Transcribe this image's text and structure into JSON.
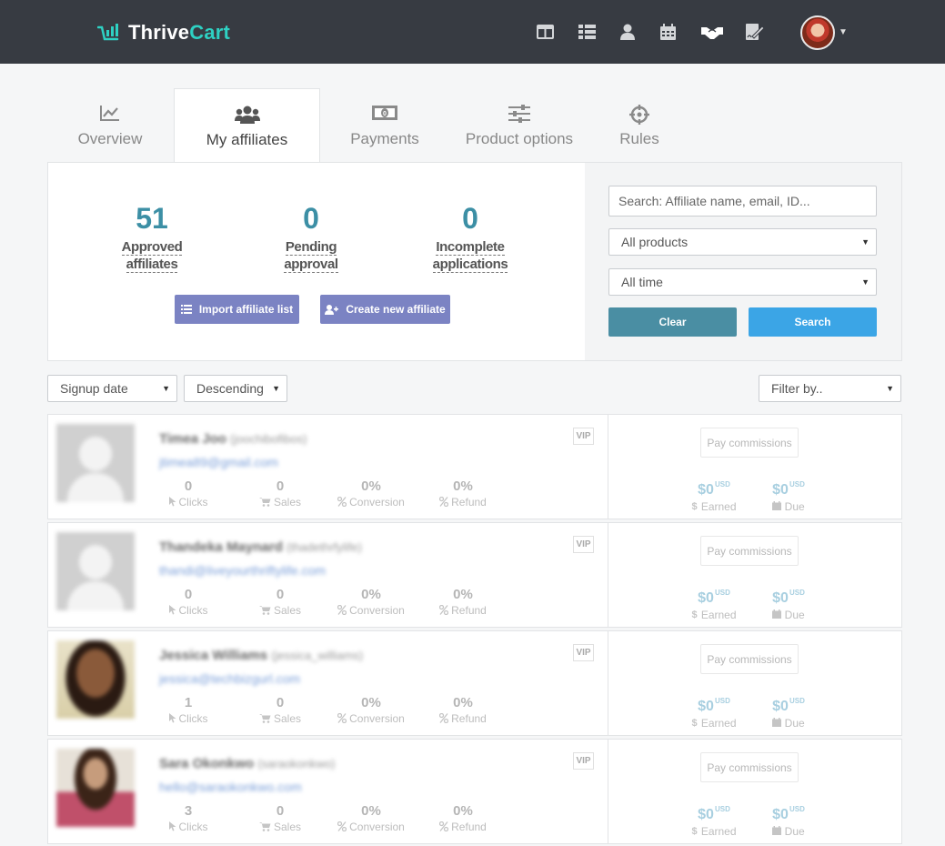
{
  "header": {
    "brand_left": "Thrive",
    "brand_right": "Cart",
    "nav_icons": [
      "dashboard-icon",
      "products-icon",
      "user-icon",
      "calendar-icon",
      "affiliates-handshake-icon",
      "signature-icon"
    ]
  },
  "tabs": [
    {
      "label": "Overview",
      "icon": "chart-icon"
    },
    {
      "label": "My affiliates",
      "icon": "users-icon"
    },
    {
      "label": "Payments",
      "icon": "money-icon"
    },
    {
      "label": "Product options",
      "icon": "sliders-icon"
    },
    {
      "label": "Rules",
      "icon": "crosshair-icon"
    }
  ],
  "stats": [
    {
      "value": "51",
      "line1": "Approved",
      "line2": "affiliates"
    },
    {
      "value": "0",
      "line1": "Pending",
      "line2": "approval"
    },
    {
      "value": "0",
      "line1": "Incomplete",
      "line2": "applications"
    }
  ],
  "actions": {
    "import_label": "Import affiliate list",
    "create_label": "Create new affiliate"
  },
  "search": {
    "placeholder": "Search: Affiliate name, email, ID...",
    "product_filter": "All products",
    "time_filter": "All time",
    "clear_label": "Clear",
    "search_label": "Search"
  },
  "sort": {
    "field": "Signup date",
    "order": "Descending",
    "filter": "Filter by.."
  },
  "affiliates": [
    {
      "name": "Timea Joo",
      "handle": "(joochibofibos)",
      "email": "jtimea89@gmail.com",
      "clicks": "0",
      "sales": "0",
      "conversion": "0%",
      "refund": "0%",
      "earned": "$0",
      "due": "$0"
    },
    {
      "name": "Thandeka Maynard",
      "handle": "(thadethrfylife)",
      "email": "thandi@liveyourthriftylife.com",
      "clicks": "0",
      "sales": "0",
      "conversion": "0%",
      "refund": "0%",
      "earned": "$0",
      "due": "$0"
    },
    {
      "name": "Jessica Williams",
      "handle": "(jessica_williams)",
      "email": "jessica@techbizgurl.com",
      "clicks": "1",
      "sales": "0",
      "conversion": "0%",
      "refund": "0%",
      "earned": "$0",
      "due": "$0"
    },
    {
      "name": "Sara Okonkwo",
      "handle": "(saraokonkwo)",
      "email": "hello@saraokonkwo.com",
      "clicks": "3",
      "sales": "0",
      "conversion": "0%",
      "refund": "0%",
      "earned": "$0",
      "due": "$0"
    }
  ],
  "row_labels": {
    "vip": "VIP",
    "pay": "Pay commissions",
    "clicks": "Clicks",
    "sales": "Sales",
    "conversion": "Conversion",
    "refund": "Refund",
    "earned": "Earned",
    "due": "Due",
    "currency": "USD"
  }
}
